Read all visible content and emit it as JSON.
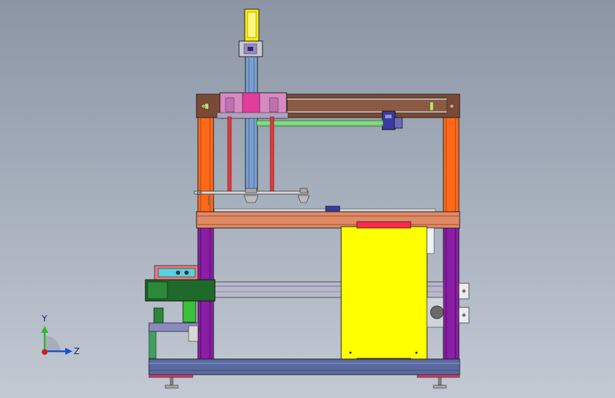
{
  "viewport": {
    "background_top": "#8c95a4",
    "background_bottom": "#c2c9d3"
  },
  "triad": {
    "y_label": "Y",
    "z_label": "Z",
    "y_color": "#2db82d",
    "z_color": "#1a4fd6",
    "origin_color": "#d11a1a"
  },
  "colors": {
    "frame_orange": "#ff6a1a",
    "frame_purple": "#8a1fa6",
    "gantry_brown": "#7a4a36",
    "table_salmon": "#e08a66",
    "base_blue": "#5a6aa0",
    "panel_yellow": "#ffff00",
    "column_blue": "#7aa0d0",
    "motor_green": "#1f6a2a",
    "accent_magenta": "#e23c9c",
    "red_rod": "#e03a3a"
  }
}
